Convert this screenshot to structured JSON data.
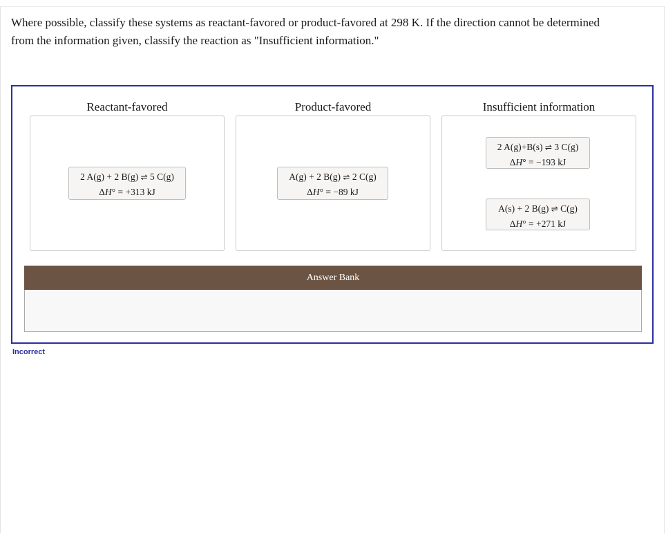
{
  "question": {
    "line1": "Where possible, classify these systems as reactant-favored or product-favored at 298 K. If the direction cannot be determined",
    "line2": "from the information given, classify the reaction as \"Insufficient information.\""
  },
  "bins": [
    {
      "title": "Reactant-favored",
      "cards": [
        {
          "eq_left": "2 A(g) + 2 B(g)",
          "arrows": "⇌",
          "eq_right": "5 C(g)",
          "dh_prefix": "Δ",
          "dh_symbol": "H",
          "dh_suffix": "° = +313 kJ"
        }
      ]
    },
    {
      "title": "Product-favored",
      "cards": [
        {
          "eq_left": "A(g) + 2 B(g)",
          "arrows": "⇌",
          "eq_right": "2 C(g)",
          "dh_prefix": "Δ",
          "dh_symbol": "H",
          "dh_suffix": "° = −89 kJ"
        }
      ]
    },
    {
      "title": "Insufficient information",
      "cards": [
        {
          "eq_left": "2 A(g)+B(s)",
          "arrows": "⇌",
          "eq_right": "3 C(g)",
          "dh_prefix": "Δ",
          "dh_symbol": "H",
          "dh_suffix": "° = −193 kJ"
        },
        {
          "eq_left": "A(s) + 2 B(g)",
          "arrows": "⇌",
          "eq_right": "C(g)",
          "dh_prefix": "Δ",
          "dh_symbol": "H",
          "dh_suffix": "° = +271 kJ"
        }
      ]
    }
  ],
  "answer_bank": {
    "label": "Answer Bank"
  },
  "status": {
    "text": "Incorrect",
    "color": "#2b2f9e"
  },
  "colors": {
    "frame_border": "#2b2f9e",
    "bank_header_bg": "#6b5444"
  }
}
